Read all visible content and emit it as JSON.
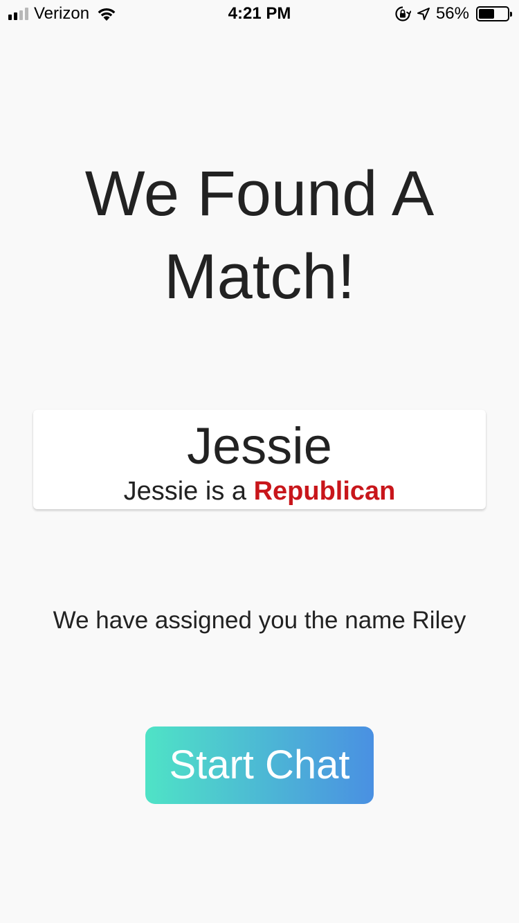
{
  "status_bar": {
    "carrier": "Verizon",
    "time": "4:21 PM",
    "battery_percent": "56%",
    "battery_level": 0.56,
    "signal_bars": 2,
    "signal_bars_total": 4,
    "icons": [
      "signal-icon",
      "wifi-icon",
      "rotation-lock-icon",
      "location-arrow-icon",
      "battery-icon"
    ]
  },
  "title": {
    "line1": "We Found A",
    "line2": "Match!"
  },
  "match": {
    "name": "Jessie",
    "party_prefix": "Jessie is a ",
    "party": "Republican",
    "party_color": "#c8161b"
  },
  "assigned_text": "We have assigned you the name Riley",
  "start_button": {
    "label": "Start Chat",
    "gradient_start": "#4fe3c6",
    "gradient_end": "#4a90e2"
  }
}
